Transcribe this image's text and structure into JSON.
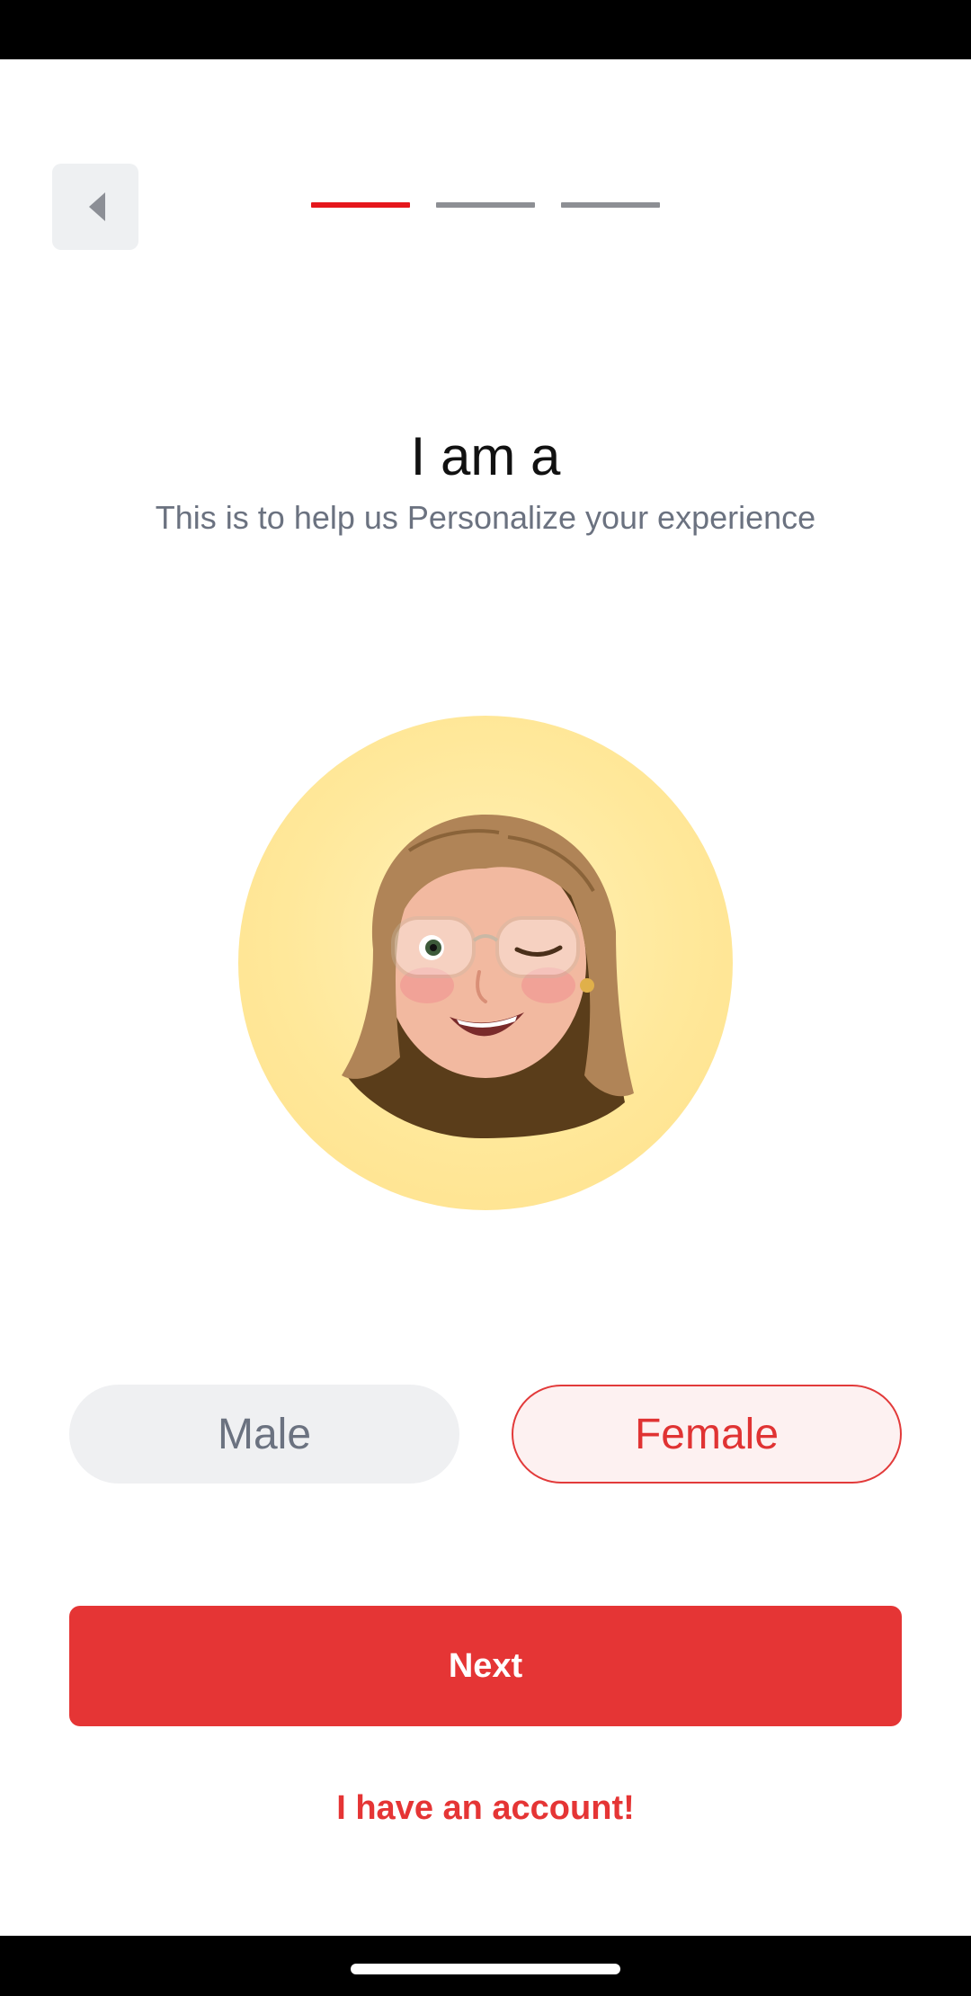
{
  "header": {
    "back_icon": "chevron-left-icon",
    "progress": {
      "total_steps": 3,
      "current_step": 1
    }
  },
  "main": {
    "title": "I am a",
    "subtitle": "This is to help us Personalize your experience",
    "avatar_icon": "female-memoji-avatar"
  },
  "gender_options": {
    "male_label": "Male",
    "female_label": "Female",
    "selected": "Female"
  },
  "actions": {
    "next_label": "Next",
    "account_link": "I have an account!"
  },
  "colors": {
    "accent": "#e53535",
    "progress_active": "#e5171c",
    "progress_inactive": "#8d8f94",
    "avatar_bg": "#ffe89a"
  }
}
